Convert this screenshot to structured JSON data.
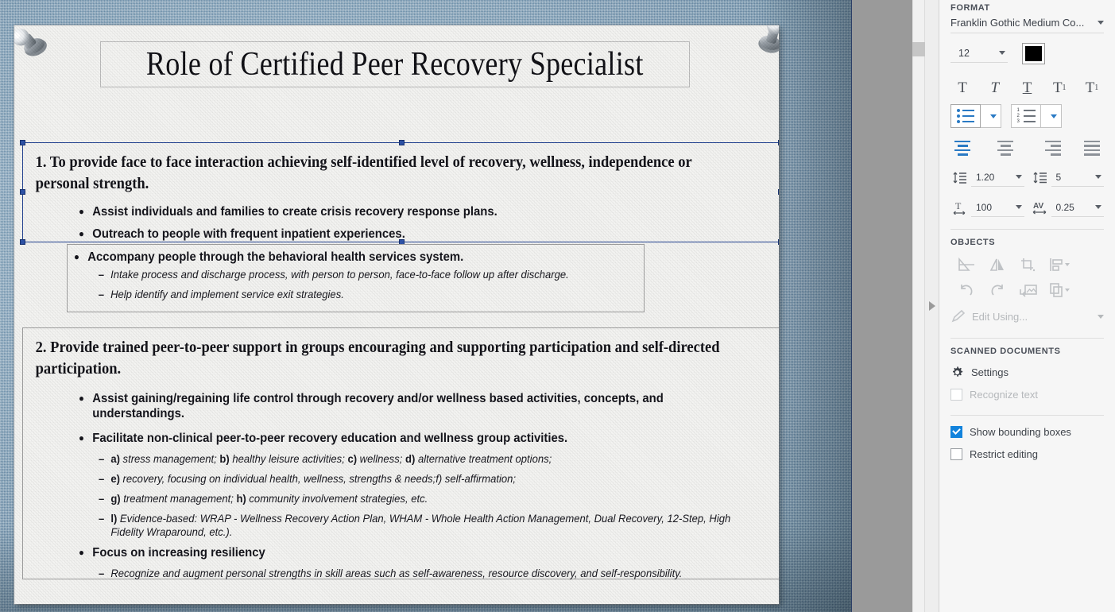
{
  "document": {
    "title": "Role of Certified Peer Recovery Specialist",
    "sections": [
      {
        "heading": "1. To provide face to face interaction achieving self-identified level of recovery, wellness, independence or personal strength.",
        "bullets": [
          {
            "text": "Assist individuals and families to create crisis recovery response plans.",
            "sub": []
          },
          {
            "text": "Outreach to people with frequent inpatient experiences.",
            "sub": []
          }
        ]
      },
      {
        "bullets": [
          {
            "text": "Accompany people through the behavioral health services system.",
            "sub": [
              "Intake process and discharge process, with person to person, face-to-face follow up after discharge.",
              "Help identify and implement service exit strategies."
            ]
          }
        ]
      },
      {
        "heading": "2. Provide trained peer-to-peer support in groups encouraging and supporting participation and self-directed participation.",
        "bullets": [
          {
            "text": "Assist gaining/regaining life control through recovery and/or wellness based activities, concepts, and understandings.",
            "sub": []
          },
          {
            "text": "Facilitate non-clinical peer-to-peer recovery education and wellness group activities.",
            "sub": [
              "a) stress management;  b) healthy leisure activities; c) wellness; d) alternative treatment options;",
              "e) recovery, focusing on individual health, wellness, strengths & needs;f) self-affirmation;",
              "g) treatment management; h) community involvement strategies, etc.",
              "l) Evidence-based: WRAP - Wellness Recovery Action Plan, WHAM - Whole Health Action Management, Dual Recovery, 12-Step, High Fidelity Wraparound, etc.)."
            ]
          },
          {
            "text": "Focus on increasing resiliency",
            "sub": [
              "Recognize and augment personal strengths in skill areas such as self-awareness, resource discovery, and self-responsibility."
            ]
          }
        ]
      }
    ]
  },
  "panel": {
    "format_label": "FORMAT",
    "font_family": "Franklin Gothic Medium Co...",
    "font_size": "12",
    "text_color": "#000000",
    "accent_color": "#1283dc",
    "style_buttons": [
      {
        "name": "bold",
        "glyph": "T"
      },
      {
        "name": "italic",
        "glyph": "T"
      },
      {
        "name": "underline",
        "glyph": "T"
      },
      {
        "name": "superscript",
        "glyph": "T",
        "mark": "1"
      },
      {
        "name": "subscript",
        "glyph": "T",
        "mark": "1"
      }
    ],
    "line_spacing": "1.20",
    "paragraph_spacing": "5",
    "character_scale": "100",
    "character_tracking": "0.25",
    "objects_label": "OBJECTS",
    "edit_using_label": "Edit Using...",
    "scanned_documents_label": "SCANNED DOCUMENTS",
    "settings_label": "Settings",
    "recognize_text_label": "Recognize text",
    "recognize_text_checked": false,
    "show_bounding_boxes_label": "Show bounding boxes",
    "show_bounding_boxes_checked": true,
    "restrict_editing_label": "Restrict editing",
    "restrict_editing_checked": false
  }
}
